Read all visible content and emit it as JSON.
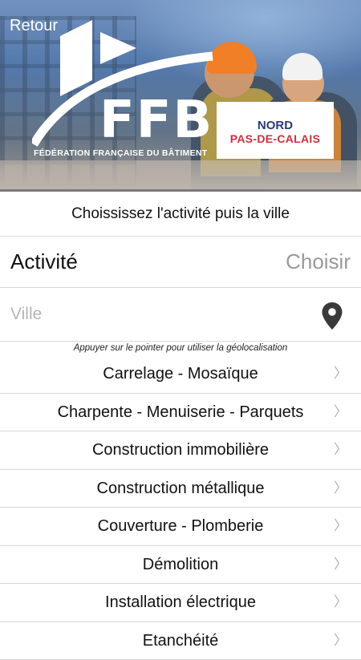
{
  "header": {
    "back_label": "Retour",
    "logo_text": "FFB",
    "logo_subtitle": "FÉDÉRATION FRANÇAISE DU BÂTIMENT",
    "region_line1": "NORD",
    "region_line2": "PAS-DE-CALAIS"
  },
  "instruction": "Choississez l'activité puis la ville",
  "activity": {
    "label": "Activité",
    "value": "Choisir"
  },
  "city": {
    "placeholder": "Ville",
    "icon": "map-pin-icon"
  },
  "hint": "Appuyer sur le pointer pour utiliser la géolocalisation",
  "activities": [
    "Carrelage - Mosaïque",
    "Charpente - Menuiserie - Parquets",
    "Construction immobilière",
    "Construction métallique",
    "Couverture - Plomberie",
    "Démolition",
    "Installation électrique",
    "Etanchéité"
  ],
  "chevron_icon": "chevron-right-icon",
  "colors": {
    "region_blue": "#2b3a7a",
    "region_red": "#c8323c",
    "placeholder_gray": "#9a9a9a"
  }
}
